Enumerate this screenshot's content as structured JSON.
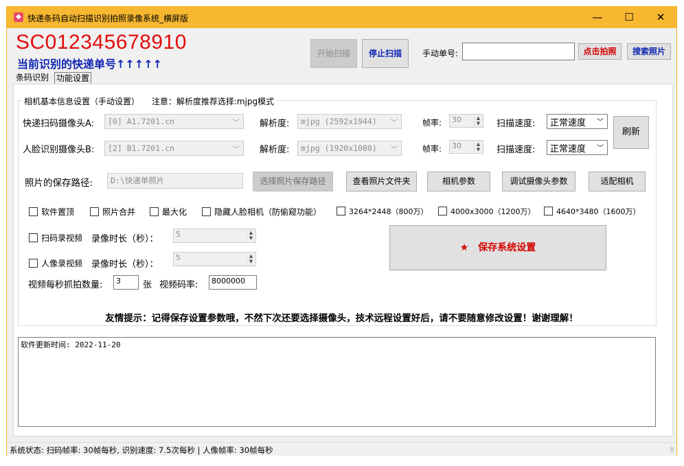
{
  "window": {
    "title": "快递条码自动扫描识别拍照录像系统_横屏版",
    "minimize": "—",
    "maximize": "☐",
    "close": "✕"
  },
  "header": {
    "barcode": "SC012345678910",
    "barcode_caption": "当前识别的快递单号↑↑↑↑↑",
    "start_scan": "开始扫描",
    "stop_scan": "停止扫描",
    "manual_label": "手动单号:",
    "manual_value": "",
    "take_photo": "点击拍照",
    "search_photo": "搜索照片"
  },
  "tabs": [
    "条码识别",
    "功能设置"
  ],
  "settings": {
    "group_title": "相机基本信息设置（手动设置）",
    "group_note": "注意：解析度推荐选择:mjpg模式",
    "camera_a_label": "快递扫码摄像头A:",
    "camera_a_value": "[0] A1.7201.cn",
    "camera_b_label": "人脸识别摄像头B:",
    "camera_b_value": "[2] B1.7201.cn",
    "resolution_label": "解析度:",
    "resolution_a_value": "mjpg (2592x1944)",
    "resolution_b_value": "mjpg (1920x1080)",
    "fps_label": "帧率:",
    "fps_a_value": "30",
    "fps_b_value": "30",
    "scan_speed_label": "扫描速度:",
    "scan_speed_a_value": "正常速度",
    "scan_speed_b_value": "正常速度",
    "refresh": "刷新",
    "photo_path_label": "照片的保存路径:",
    "photo_path_value": "D:\\快递单照片",
    "choose_path": "选择照片保存路径",
    "view_folder": "查看照片文件夹",
    "camera_params": "相机参数",
    "debug_params": "调试摄像头参数",
    "adapt_camera": "适配相机",
    "checkboxes": [
      "软件置顶",
      "照片合并",
      "最大化",
      "隐藏人脸相机（防偷窥功能）",
      "3264*2448（800万）",
      "4000x3000（1200万）",
      "4640*3480（1600万）"
    ],
    "scan_record": "扫码录视频",
    "face_record": "人像录视频",
    "record_duration_label": "录像时长（秒）：",
    "scan_record_duration": "5",
    "face_record_duration": "5",
    "capture_per_sec_label": "视频每秒抓拍数量:",
    "capture_per_sec_value": "3",
    "capture_unit": "张",
    "bitrate_label": "视频码率:",
    "bitrate_value": "8000000",
    "save_settings": "保存系统设置",
    "tip": "友情提示：记得保存设置参数哦，不然下次还要选择摄像头，技术远程设置好后，请不要随意修改设置！谢谢理解！"
  },
  "log": {
    "text": "软件更新时间: 2022-11-20"
  },
  "status": {
    "text": "系统状态: 扫码帧率: 30帧每秒, 识别速度: 7.5次每秒 |   人像帧率: 30帧每秒"
  },
  "colors": {
    "titlebar": "#f7b731",
    "barcode": "#e30d0d",
    "caption": "#1025b3",
    "accent_red": "#d40000"
  }
}
